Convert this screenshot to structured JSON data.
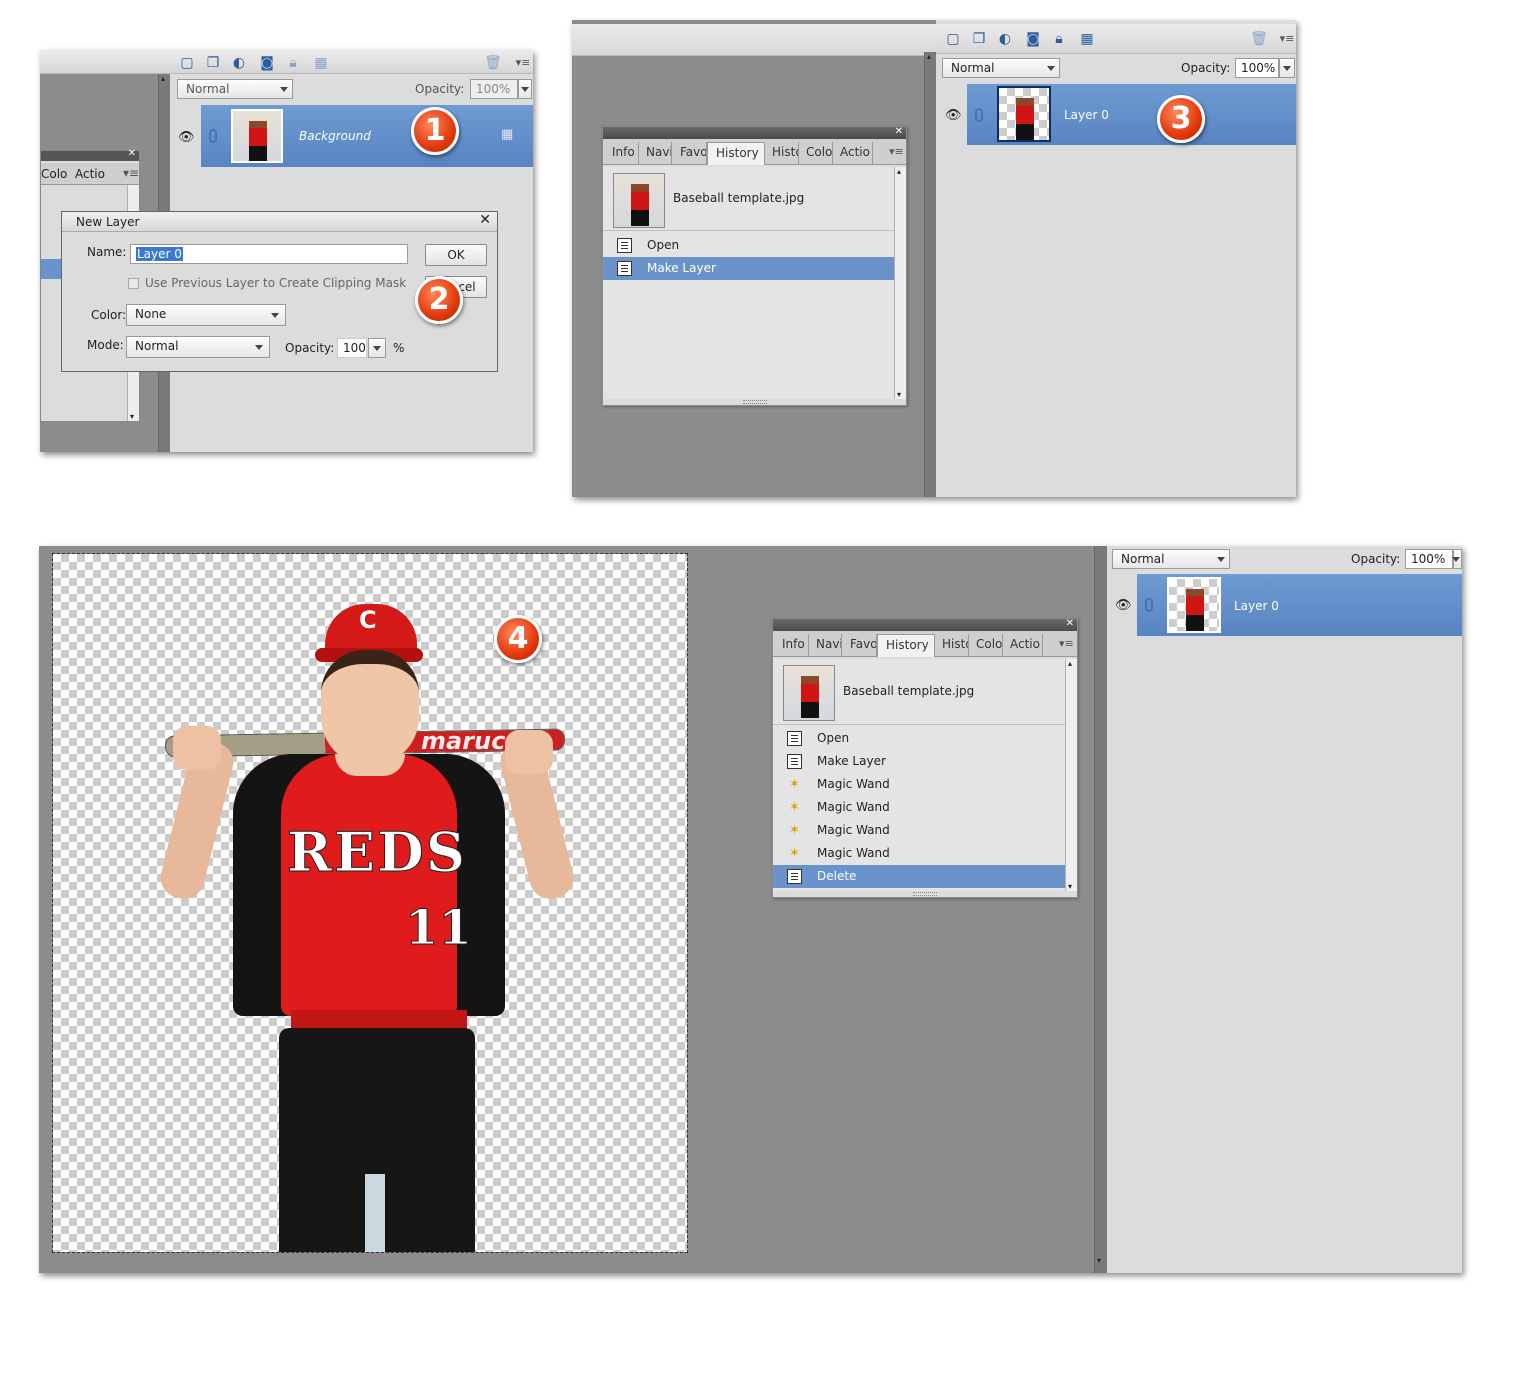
{
  "panel1": {
    "blend_mode": "Normal",
    "opacity_label": "Opacity:",
    "opacity_value": "100%",
    "layer_name": "Background",
    "left_tabs": [
      "Colo",
      "Actio"
    ]
  },
  "dialog": {
    "title": "New Layer",
    "name_label": "Name:",
    "name_value": "Layer 0",
    "ok_label": "OK",
    "cancel_label": "cel",
    "clip_label": "Use Previous Layer to Create Clipping Mask",
    "color_label": "Color:",
    "color_value": "None",
    "mode_label": "Mode:",
    "mode_value": "Normal",
    "opacity_label": "Opacity:",
    "opacity_value": "100",
    "percent": "%"
  },
  "panel3": {
    "blend_mode": "Normal",
    "opacity_label": "Opacity:",
    "opacity_value": "100%",
    "layer_name": "Layer 0"
  },
  "history_small": {
    "tabs": [
      "Info",
      "Navi",
      "Favo",
      "History",
      "Histo",
      "Colo",
      "Actio"
    ],
    "snapshot": "Baseball template.jpg",
    "items": [
      {
        "label": "Open",
        "icon": "doc-icon"
      },
      {
        "label": "Make Layer",
        "icon": "doc-icon",
        "selected": true
      }
    ]
  },
  "history_large": {
    "tabs": [
      "Info",
      "Navi",
      "Favo",
      "History",
      "Histo",
      "Colo",
      "Actio"
    ],
    "snapshot": "Baseball template.jpg",
    "items": [
      {
        "label": "Open",
        "icon": "doc-icon"
      },
      {
        "label": "Make Layer",
        "icon": "doc-icon"
      },
      {
        "label": "Magic Wand",
        "icon": "magic-wand-icon"
      },
      {
        "label": "Magic Wand",
        "icon": "magic-wand-icon"
      },
      {
        "label": "Magic Wand",
        "icon": "magic-wand-icon"
      },
      {
        "label": "Magic Wand",
        "icon": "magic-wand-icon"
      },
      {
        "label": "Delete",
        "icon": "doc-icon",
        "selected": true
      }
    ]
  },
  "panel4": {
    "blend_mode": "Normal",
    "opacity_label": "Opacity:",
    "opacity_value": "100%",
    "layer_name": "Layer 0"
  },
  "photo": {
    "jersey_text": "REDS",
    "number": "11",
    "bat_text": "marucci"
  },
  "badges": [
    "1",
    "2",
    "3",
    "4"
  ],
  "colors": {
    "selection_blue": "#5884c2",
    "badge_red": "#e2380d",
    "panel_gray": "#dcdcdc",
    "workspace_gray": "#8c8c8c"
  }
}
